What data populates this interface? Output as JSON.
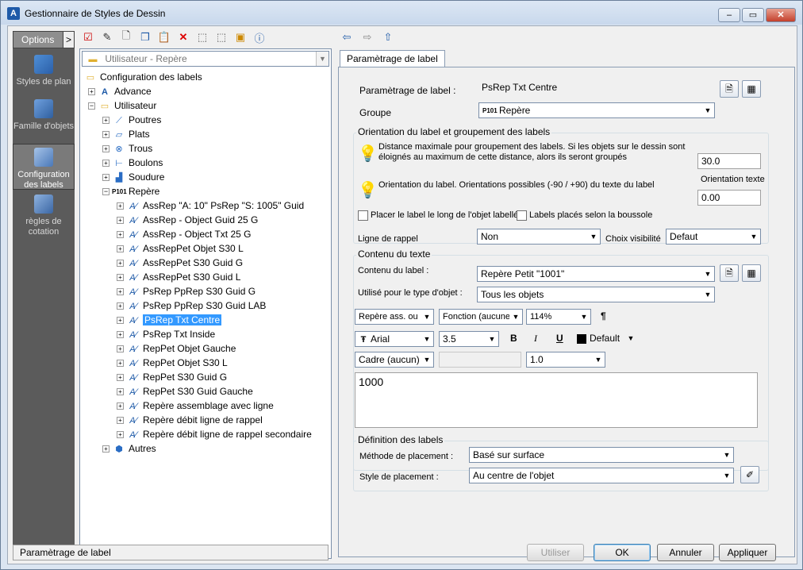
{
  "window": {
    "title": "Gestionnaire de Styles de Dessin",
    "app_icon": "A",
    "controls": {
      "minimize": "–",
      "maximize": "▭",
      "close": "✕"
    }
  },
  "toolbar": {
    "icons": [
      "check-style-icon",
      "edit-style-icon",
      "new-style-icon",
      "copy-icon",
      "paste-icon",
      "delete-icon",
      "import-icon",
      "export-icon",
      "preview-icon",
      "help-icon"
    ],
    "nav_icons": [
      "back-arrow-icon",
      "forward-arrow-icon",
      "up-arrow-icon"
    ]
  },
  "sidebar": {
    "options_label": "Options",
    "options_arrow": ">",
    "items": [
      {
        "label": "Styles de plan",
        "icon": "plan-styles-icon"
      },
      {
        "label": "Famille d'objets",
        "icon": "object-family-icon"
      },
      {
        "label": "Configuration des labels",
        "icon": "label-config-icon",
        "active": true
      },
      {
        "label": "règles de cotation",
        "icon": "dimension-rules-icon"
      }
    ]
  },
  "tree": {
    "filter_value": "Utilisateur - Repère",
    "root": "Configuration des labels",
    "advance": "Advance",
    "utilisateur": "Utilisateur",
    "categories": [
      "Poutres",
      "Plats",
      "Trous",
      "Boulons",
      "Soudure"
    ],
    "repere": "Repère",
    "repere_items": [
      "AssRep \"A: 10\" PsRep \"S: 1005\" Guid",
      "AssRep - Object Guid 25 G",
      "AssRep - Object Txt 25 G",
      "AssRepPet Objet S30 L",
      "AssRepPet S30 Guid G",
      "AssRepPet S30 Guid L",
      "PsRep PpRep S30 Guid G",
      "PsRep PpRep S30 Guid LAB",
      "PsRep Txt Centre",
      "PsRep Txt Inside",
      "RepPet Objet Gauche",
      "RepPet Objet S30 L",
      "RepPet S30 Guid G",
      "RepPet S30 Guid Gauche",
      "Repère assemblage avec ligne",
      "Repère débit ligne de rappel",
      "Repère débit ligne de rappel secondaire"
    ],
    "selected": "PsRep Txt Centre",
    "autres": "Autres",
    "badge_p101": "P101"
  },
  "tab": {
    "label": "Paramètrage de label"
  },
  "form": {
    "param_label": "Paramètrage de label :",
    "param_value": "PsRep Txt Centre",
    "groupe_label": "Groupe",
    "groupe_value": "Repère",
    "orientation_group": "Orientation du label et groupement des labels",
    "distance_text": "Distance maximale pour groupement des labels. Si les objets sur le dessin sont éloignés au maximum de cette distance, alors ils seront groupés",
    "distance_value": "30.0",
    "orientation_text": "Orientation du label. Orientations possibles (-90 / +90) du texte du label",
    "orientation_texte_label": "Orientation texte",
    "orientation_value": "0.00",
    "chk_placer": "Placer le label le long de l'objet labellé",
    "chk_boussole": "Labels placés selon la boussole",
    "ligne_rappel_label": "Ligne de rappel",
    "ligne_rappel_value": "Non",
    "choix_visibilite_label": "Choix visibilité",
    "choix_visibilite_value": "Defaut",
    "contenu_group": "Contenu du texte",
    "contenu_label": "Contenu du label :",
    "contenu_value": "Repère Petit \"1001\"",
    "utilise_label": "Utilisé pour le type d'objet :",
    "utilise_value": "Tous les objets",
    "fmt_repere": "Repère ass. ou s",
    "fmt_fonction": "Fonction (aucune",
    "fmt_pct": "114%",
    "fmt_para": "¶",
    "font_name": "Arial",
    "font_size": "3.5",
    "bold": "B",
    "italic": "I",
    "underline": "U",
    "color_value": "Default",
    "cadre_value": "Cadre (aucun)",
    "spacing_value": "1.0",
    "text_content": "1000",
    "definition_group": "Définition des labels",
    "methode_label": "Méthode de placement :",
    "methode_value": "Basé sur surface",
    "style_label": "Style de placement :",
    "style_value": "Au centre de l'objet"
  },
  "status": {
    "text": "Paramètrage de label"
  },
  "buttons": {
    "utiliser": "Utiliser",
    "ok": "OK",
    "annuler": "Annuler",
    "appliquer": "Appliquer"
  },
  "colors": {
    "accent": "#3399ff",
    "sidebar": "#5b5b5b"
  }
}
